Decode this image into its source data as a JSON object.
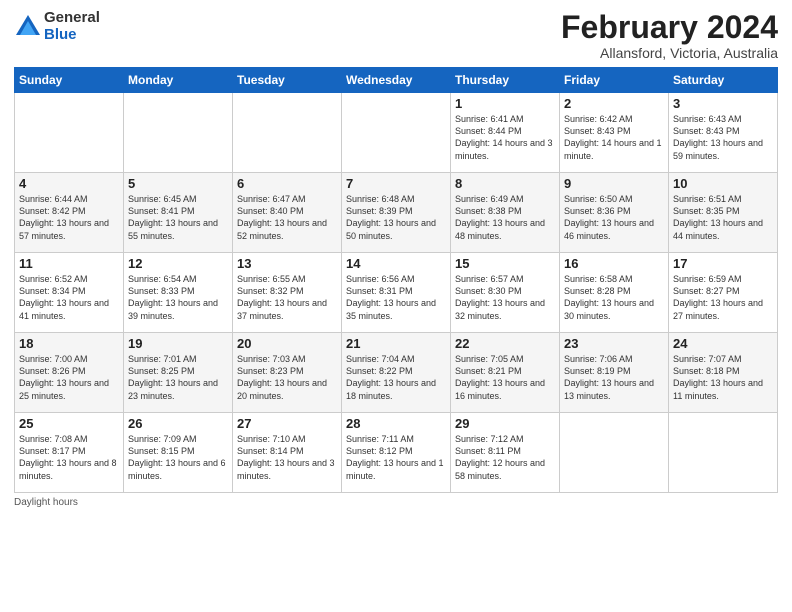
{
  "logo": {
    "general": "General",
    "blue": "Blue"
  },
  "title": "February 2024",
  "subtitle": "Allansford, Victoria, Australia",
  "days_of_week": [
    "Sunday",
    "Monday",
    "Tuesday",
    "Wednesday",
    "Thursday",
    "Friday",
    "Saturday"
  ],
  "footer": "Daylight hours",
  "weeks": [
    [
      {
        "day": "",
        "info": ""
      },
      {
        "day": "",
        "info": ""
      },
      {
        "day": "",
        "info": ""
      },
      {
        "day": "",
        "info": ""
      },
      {
        "day": "1",
        "info": "Sunrise: 6:41 AM\nSunset: 8:44 PM\nDaylight: 14 hours\nand 3 minutes."
      },
      {
        "day": "2",
        "info": "Sunrise: 6:42 AM\nSunset: 8:43 PM\nDaylight: 14 hours\nand 1 minute."
      },
      {
        "day": "3",
        "info": "Sunrise: 6:43 AM\nSunset: 8:43 PM\nDaylight: 13 hours\nand 59 minutes."
      }
    ],
    [
      {
        "day": "4",
        "info": "Sunrise: 6:44 AM\nSunset: 8:42 PM\nDaylight: 13 hours\nand 57 minutes."
      },
      {
        "day": "5",
        "info": "Sunrise: 6:45 AM\nSunset: 8:41 PM\nDaylight: 13 hours\nand 55 minutes."
      },
      {
        "day": "6",
        "info": "Sunrise: 6:47 AM\nSunset: 8:40 PM\nDaylight: 13 hours\nand 52 minutes."
      },
      {
        "day": "7",
        "info": "Sunrise: 6:48 AM\nSunset: 8:39 PM\nDaylight: 13 hours\nand 50 minutes."
      },
      {
        "day": "8",
        "info": "Sunrise: 6:49 AM\nSunset: 8:38 PM\nDaylight: 13 hours\nand 48 minutes."
      },
      {
        "day": "9",
        "info": "Sunrise: 6:50 AM\nSunset: 8:36 PM\nDaylight: 13 hours\nand 46 minutes."
      },
      {
        "day": "10",
        "info": "Sunrise: 6:51 AM\nSunset: 8:35 PM\nDaylight: 13 hours\nand 44 minutes."
      }
    ],
    [
      {
        "day": "11",
        "info": "Sunrise: 6:52 AM\nSunset: 8:34 PM\nDaylight: 13 hours\nand 41 minutes."
      },
      {
        "day": "12",
        "info": "Sunrise: 6:54 AM\nSunset: 8:33 PM\nDaylight: 13 hours\nand 39 minutes."
      },
      {
        "day": "13",
        "info": "Sunrise: 6:55 AM\nSunset: 8:32 PM\nDaylight: 13 hours\nand 37 minutes."
      },
      {
        "day": "14",
        "info": "Sunrise: 6:56 AM\nSunset: 8:31 PM\nDaylight: 13 hours\nand 35 minutes."
      },
      {
        "day": "15",
        "info": "Sunrise: 6:57 AM\nSunset: 8:30 PM\nDaylight: 13 hours\nand 32 minutes."
      },
      {
        "day": "16",
        "info": "Sunrise: 6:58 AM\nSunset: 8:28 PM\nDaylight: 13 hours\nand 30 minutes."
      },
      {
        "day": "17",
        "info": "Sunrise: 6:59 AM\nSunset: 8:27 PM\nDaylight: 13 hours\nand 27 minutes."
      }
    ],
    [
      {
        "day": "18",
        "info": "Sunrise: 7:00 AM\nSunset: 8:26 PM\nDaylight: 13 hours\nand 25 minutes."
      },
      {
        "day": "19",
        "info": "Sunrise: 7:01 AM\nSunset: 8:25 PM\nDaylight: 13 hours\nand 23 minutes."
      },
      {
        "day": "20",
        "info": "Sunrise: 7:03 AM\nSunset: 8:23 PM\nDaylight: 13 hours\nand 20 minutes."
      },
      {
        "day": "21",
        "info": "Sunrise: 7:04 AM\nSunset: 8:22 PM\nDaylight: 13 hours\nand 18 minutes."
      },
      {
        "day": "22",
        "info": "Sunrise: 7:05 AM\nSunset: 8:21 PM\nDaylight: 13 hours\nand 16 minutes."
      },
      {
        "day": "23",
        "info": "Sunrise: 7:06 AM\nSunset: 8:19 PM\nDaylight: 13 hours\nand 13 minutes."
      },
      {
        "day": "24",
        "info": "Sunrise: 7:07 AM\nSunset: 8:18 PM\nDaylight: 13 hours\nand 11 minutes."
      }
    ],
    [
      {
        "day": "25",
        "info": "Sunrise: 7:08 AM\nSunset: 8:17 PM\nDaylight: 13 hours\nand 8 minutes."
      },
      {
        "day": "26",
        "info": "Sunrise: 7:09 AM\nSunset: 8:15 PM\nDaylight: 13 hours\nand 6 minutes."
      },
      {
        "day": "27",
        "info": "Sunrise: 7:10 AM\nSunset: 8:14 PM\nDaylight: 13 hours\nand 3 minutes."
      },
      {
        "day": "28",
        "info": "Sunrise: 7:11 AM\nSunset: 8:12 PM\nDaylight: 13 hours\nand 1 minute."
      },
      {
        "day": "29",
        "info": "Sunrise: 7:12 AM\nSunset: 8:11 PM\nDaylight: 12 hours\nand 58 minutes."
      },
      {
        "day": "",
        "info": ""
      },
      {
        "day": "",
        "info": ""
      }
    ]
  ]
}
